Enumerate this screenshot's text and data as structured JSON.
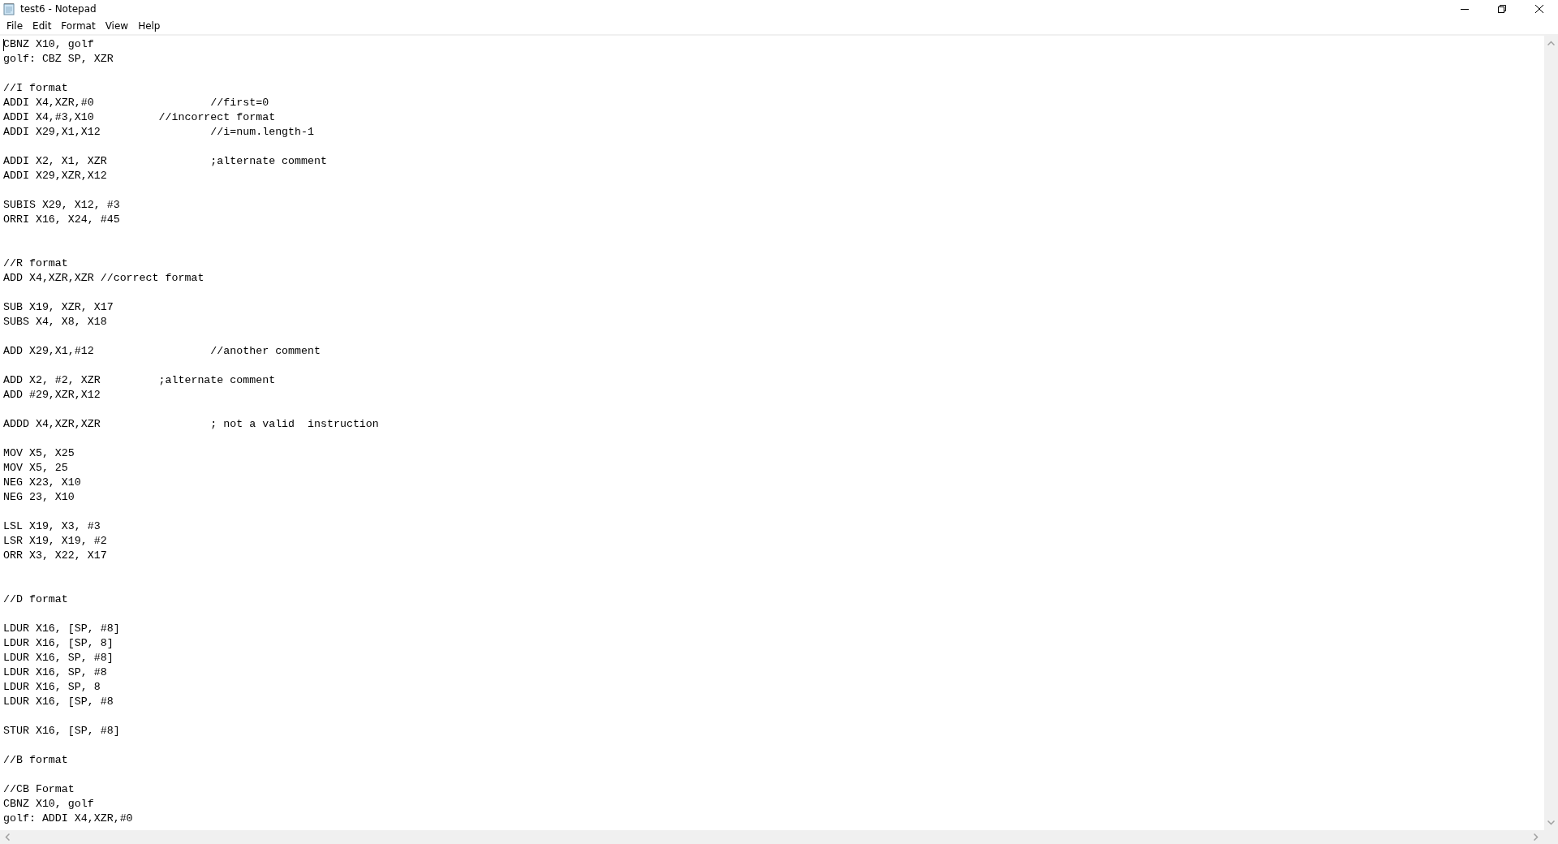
{
  "window": {
    "title": "test6 - Notepad"
  },
  "menu": [
    {
      "label": "File"
    },
    {
      "label": "Edit"
    },
    {
      "label": "Format"
    },
    {
      "label": "View"
    },
    {
      "label": "Help"
    }
  ],
  "editor": {
    "blocks": [
      {
        "wide_gap_after": false,
        "lines": [
          "CBNZ X10, golf",
          "golf: CBZ SP, XZR"
        ]
      },
      {
        "wide_gap_after": false,
        "lines": [
          "//I format",
          "ADDI X4,XZR,#0\t\t\t//first=0",
          "ADDI X4,#3,X10\t\t//incorrect format",
          "ADDI X29,X1,X12\t\t\t//i=num.length-1"
        ]
      },
      {
        "wide_gap_after": false,
        "lines": [
          "ADDI X2, X1, XZR\t\t;alternate comment",
          "ADDI X29,XZR,X12"
        ]
      },
      {
        "wide_gap_after": true,
        "lines": [
          "SUBIS X29, X12, #3",
          "ORRI X16, X24, #45"
        ]
      },
      {
        "wide_gap_after": false,
        "lines": [
          "//R format",
          "ADD X4,XZR,XZR //correct format"
        ]
      },
      {
        "wide_gap_after": false,
        "lines": [
          "SUB X19, XZR, X17",
          "SUBS X4, X8, X18"
        ]
      },
      {
        "wide_gap_after": false,
        "lines": [
          "ADD X29,X1,#12\t\t\t//another comment"
        ]
      },
      {
        "wide_gap_after": false,
        "lines": [
          "ADD X2, #2, XZR\t\t;alternate comment",
          "ADD #29,XZR,X12"
        ]
      },
      {
        "wide_gap_after": false,
        "lines": [
          "ADDD X4,XZR,XZR\t\t\t; not a valid  instruction"
        ]
      },
      {
        "wide_gap_after": false,
        "lines": [
          "MOV X5, X25",
          "MOV X5, 25",
          "NEG X23, X10",
          "NEG 23, X10"
        ]
      },
      {
        "wide_gap_after": true,
        "lines": [
          "LSL X19, X3, #3",
          "LSR X19, X19, #2",
          "ORR X3, X22, X17"
        ]
      },
      {
        "wide_gap_after": false,
        "lines": [
          "//D format"
        ]
      },
      {
        "wide_gap_after": false,
        "lines": [
          "LDUR X16, [SP, #8]",
          "LDUR X16, [SP, 8]",
          "LDUR X16, SP, #8]",
          "LDUR X16, SP, #8",
          "LDUR X16, SP, 8",
          "LDUR X16, [SP, #8"
        ]
      },
      {
        "wide_gap_after": false,
        "lines": [
          "STUR X16, [SP, #8]"
        ]
      },
      {
        "wide_gap_after": false,
        "lines": [
          "//B format"
        ]
      },
      {
        "wide_gap_after": false,
        "lines": [
          "//CB Format",
          "CBNZ X10, golf",
          "golf: ADDI X4,XZR,#0"
        ]
      }
    ]
  }
}
